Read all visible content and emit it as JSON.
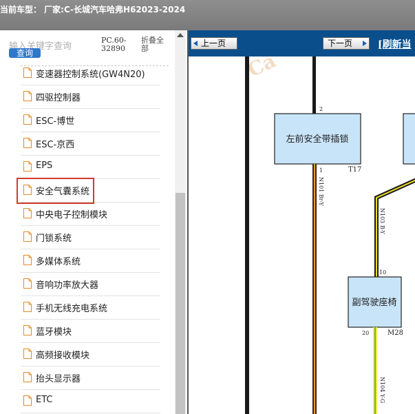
{
  "header": {
    "title": "当前车型：  厂家:C-长城汽车哈弗H62023-2024"
  },
  "sidebar": {
    "search_placeholder": "输入关键字查询",
    "search_button": "查询",
    "pc_label": "PC.60-32890",
    "collapse_label": "折叠全部",
    "items": [
      {
        "label": "变速器控制系统(GW4N20)"
      },
      {
        "label": "四驱控制器"
      },
      {
        "label": "ESC-博世"
      },
      {
        "label": "ESC-京西"
      },
      {
        "label": "EPS"
      },
      {
        "label": "安全气囊系统"
      },
      {
        "label": "中央电子控制模块"
      },
      {
        "label": "门锁系统"
      },
      {
        "label": "多媒体系统"
      },
      {
        "label": "音响功率放大器"
      },
      {
        "label": "手机无线充电系统"
      },
      {
        "label": "蓝牙模块"
      },
      {
        "label": "高频接收模块"
      },
      {
        "label": "抬头显示器"
      },
      {
        "label": "ETC"
      }
    ]
  },
  "toolbar": {
    "prev_label": "上一页",
    "next_label": "下一页",
    "refresh_label": "[刷新当"
  },
  "diagram": {
    "watermark": "Ca",
    "box1_label": "左前安全带插锁",
    "box2_label": "副驾驶座椅",
    "pin_2": "2",
    "pin_1": "1",
    "connector_t17": "T17",
    "wire_n101": "N101 Br-Y",
    "wire_n103": "N103 B-Y",
    "pin_10": "10",
    "pin_20": "20",
    "connector_m28": "M28",
    "wire_n104": "N104 Y-G"
  },
  "colors": {
    "accent": "#0a4f8c",
    "highlight": "#d23a2a",
    "box_fill": "#c8e4f8"
  }
}
